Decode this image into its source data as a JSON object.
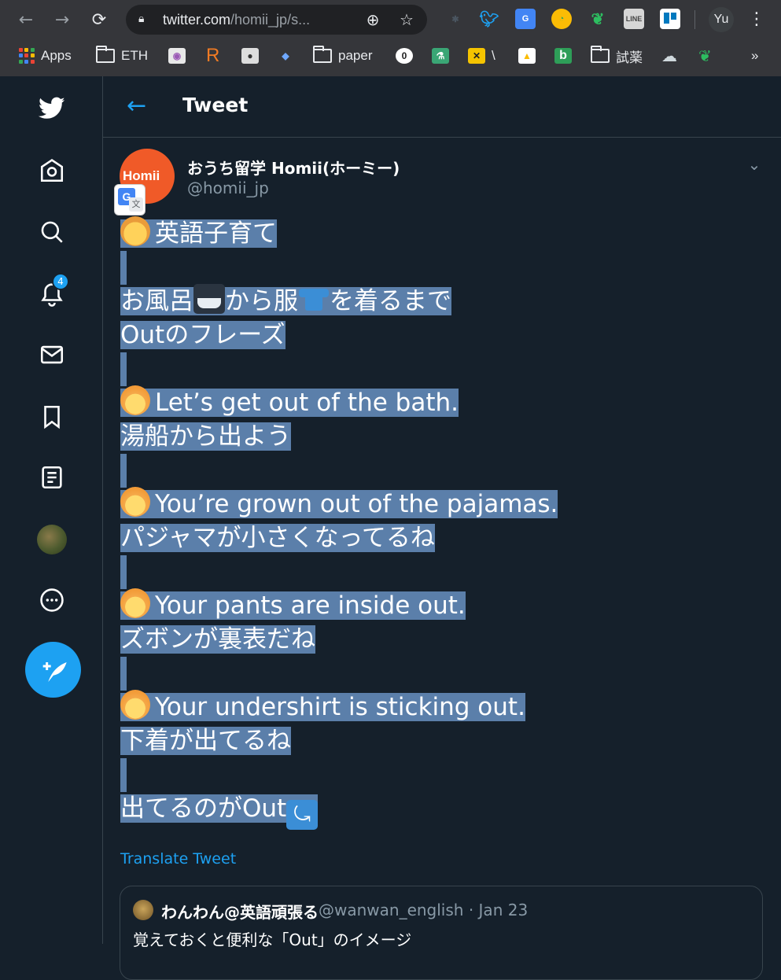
{
  "browser": {
    "url_host": "twitter.com",
    "url_path": "/homii_jp/s...",
    "profile_initials": "Yu",
    "bookmarks": {
      "apps": "Apps",
      "eth": "ETH",
      "r": "R",
      "paper": "paper",
      "slash": "\\",
      "b": "b",
      "trial": "試薬",
      "more": "»"
    }
  },
  "sidebar": {
    "notification_count": "4"
  },
  "header": {
    "title": "Tweet"
  },
  "tweet": {
    "avatar_text": "Homii",
    "author_name": "おうち留学 Homii(ホーミー)",
    "author_handle": "@homii_jp",
    "lines": {
      "l1": "英語子育て",
      "l2a": "お風呂",
      "l2b": "から服",
      "l2c": "を着るまで",
      "l3": "Outのフレーズ",
      "l4": "Let’s get out of the bath.",
      "l5": "湯船から出よう",
      "l6": "You’re grown out of the pajamas.",
      "l7": "パジャマが小さくなってるね",
      "l8": "Your pants are inside out.",
      "l9": "ズボンが裏表だね",
      "l10": "Your undershirt is sticking out.",
      "l11": "下着が出てるね",
      "l12": "出てるのがOut"
    },
    "translate_label": "Translate Tweet"
  },
  "quote": {
    "name": "わんわん@英語頑張る",
    "meta": "@wanwan_english · Jan 23",
    "text": "覚えておくと便利な「Out」のイメージ"
  },
  "colors": {
    "background": "#15202b",
    "accent": "#1da1f2",
    "selection": "#5b7faa",
    "border": "#38444d",
    "muted": "#8899a6"
  }
}
